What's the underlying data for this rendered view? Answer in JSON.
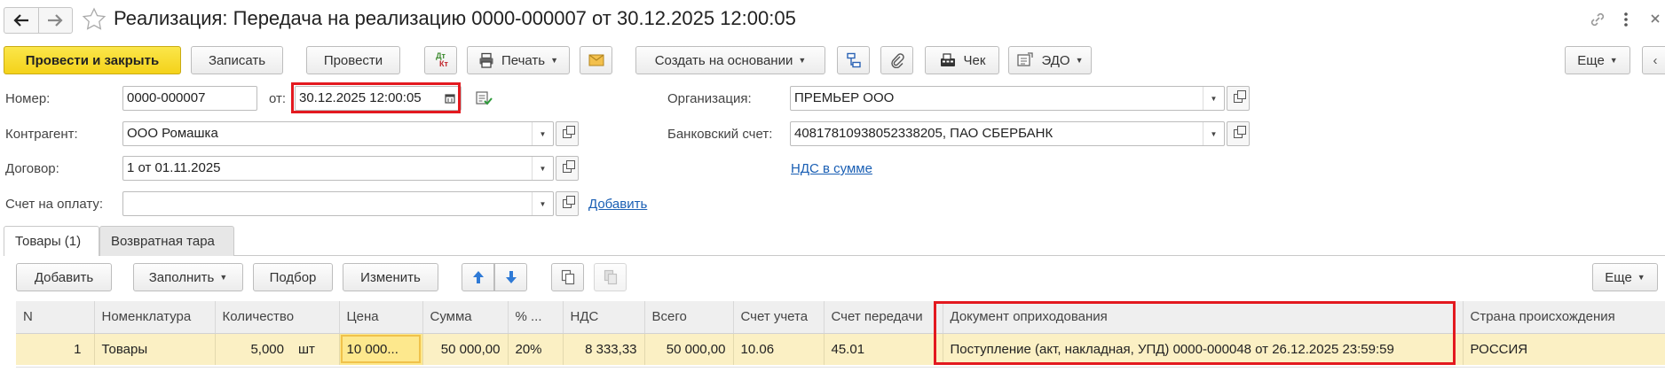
{
  "title": "Реализация: Передача на реализацию 0000-000007 от 30.12.2025 12:00:05",
  "toolbar": {
    "post_close": "Провести и закрыть",
    "save": "Записать",
    "post": "Провести",
    "dtkt_top": "Дт",
    "dtkt_bottom": "Кт",
    "print": "Печать",
    "create_based": "Создать на основании",
    "receipt": "Чек",
    "edo": "ЭДО",
    "more": "Еще"
  },
  "form": {
    "number_label": "Номер:",
    "number_value": "0000-000007",
    "date_label": "от:",
    "date_value": "30.12.2025 12:00:05",
    "org_label": "Организация:",
    "org_value": "ПРЕМЬЕР ООО",
    "counterparty_label": "Контрагент:",
    "counterparty_value": "ООО Ромашка",
    "bank_label": "Банковский счет:",
    "bank_value": "40817810938052338205, ПАО СБЕРБАНК",
    "contract_label": "Договор:",
    "contract_value": "1 от 01.11.2025",
    "vat_link": "НДС в сумме",
    "invoice_label": "Счет на оплату:",
    "invoice_value": "",
    "add_link": "Добавить"
  },
  "tabs": [
    {
      "label": "Товары (1)",
      "active": true
    },
    {
      "label": "Возвратная тара",
      "active": false
    }
  ],
  "table_toolbar": {
    "add": "Добавить",
    "fill": "Заполнить",
    "select": "Подбор",
    "change": "Изменить",
    "more": "Еще"
  },
  "table": {
    "columns": [
      "N",
      "Номенклатура",
      "Количество",
      "",
      "Цена",
      "Сумма",
      "% ...",
      "НДС",
      "Всего",
      "Счет учета",
      "Счет передачи",
      "Документ оприходования",
      "Страна происхождения"
    ],
    "rows": [
      [
        "1",
        "Товары",
        "5,000",
        "шт",
        "10 000...",
        "50 000,00",
        "20%",
        "8 333,33",
        "50 000,00",
        "10.06",
        "45.01",
        "Поступление (акт, накладная, УПД) 0000-000048 от 26.12.2025 23:59:59",
        "РОССИЯ"
      ]
    ]
  },
  "colors": {
    "highlight_red": "#e3191f",
    "primary_yellow": "#f4d21a",
    "row_yellow": "#fbf0c4",
    "link_blue": "#1a5fb4"
  }
}
